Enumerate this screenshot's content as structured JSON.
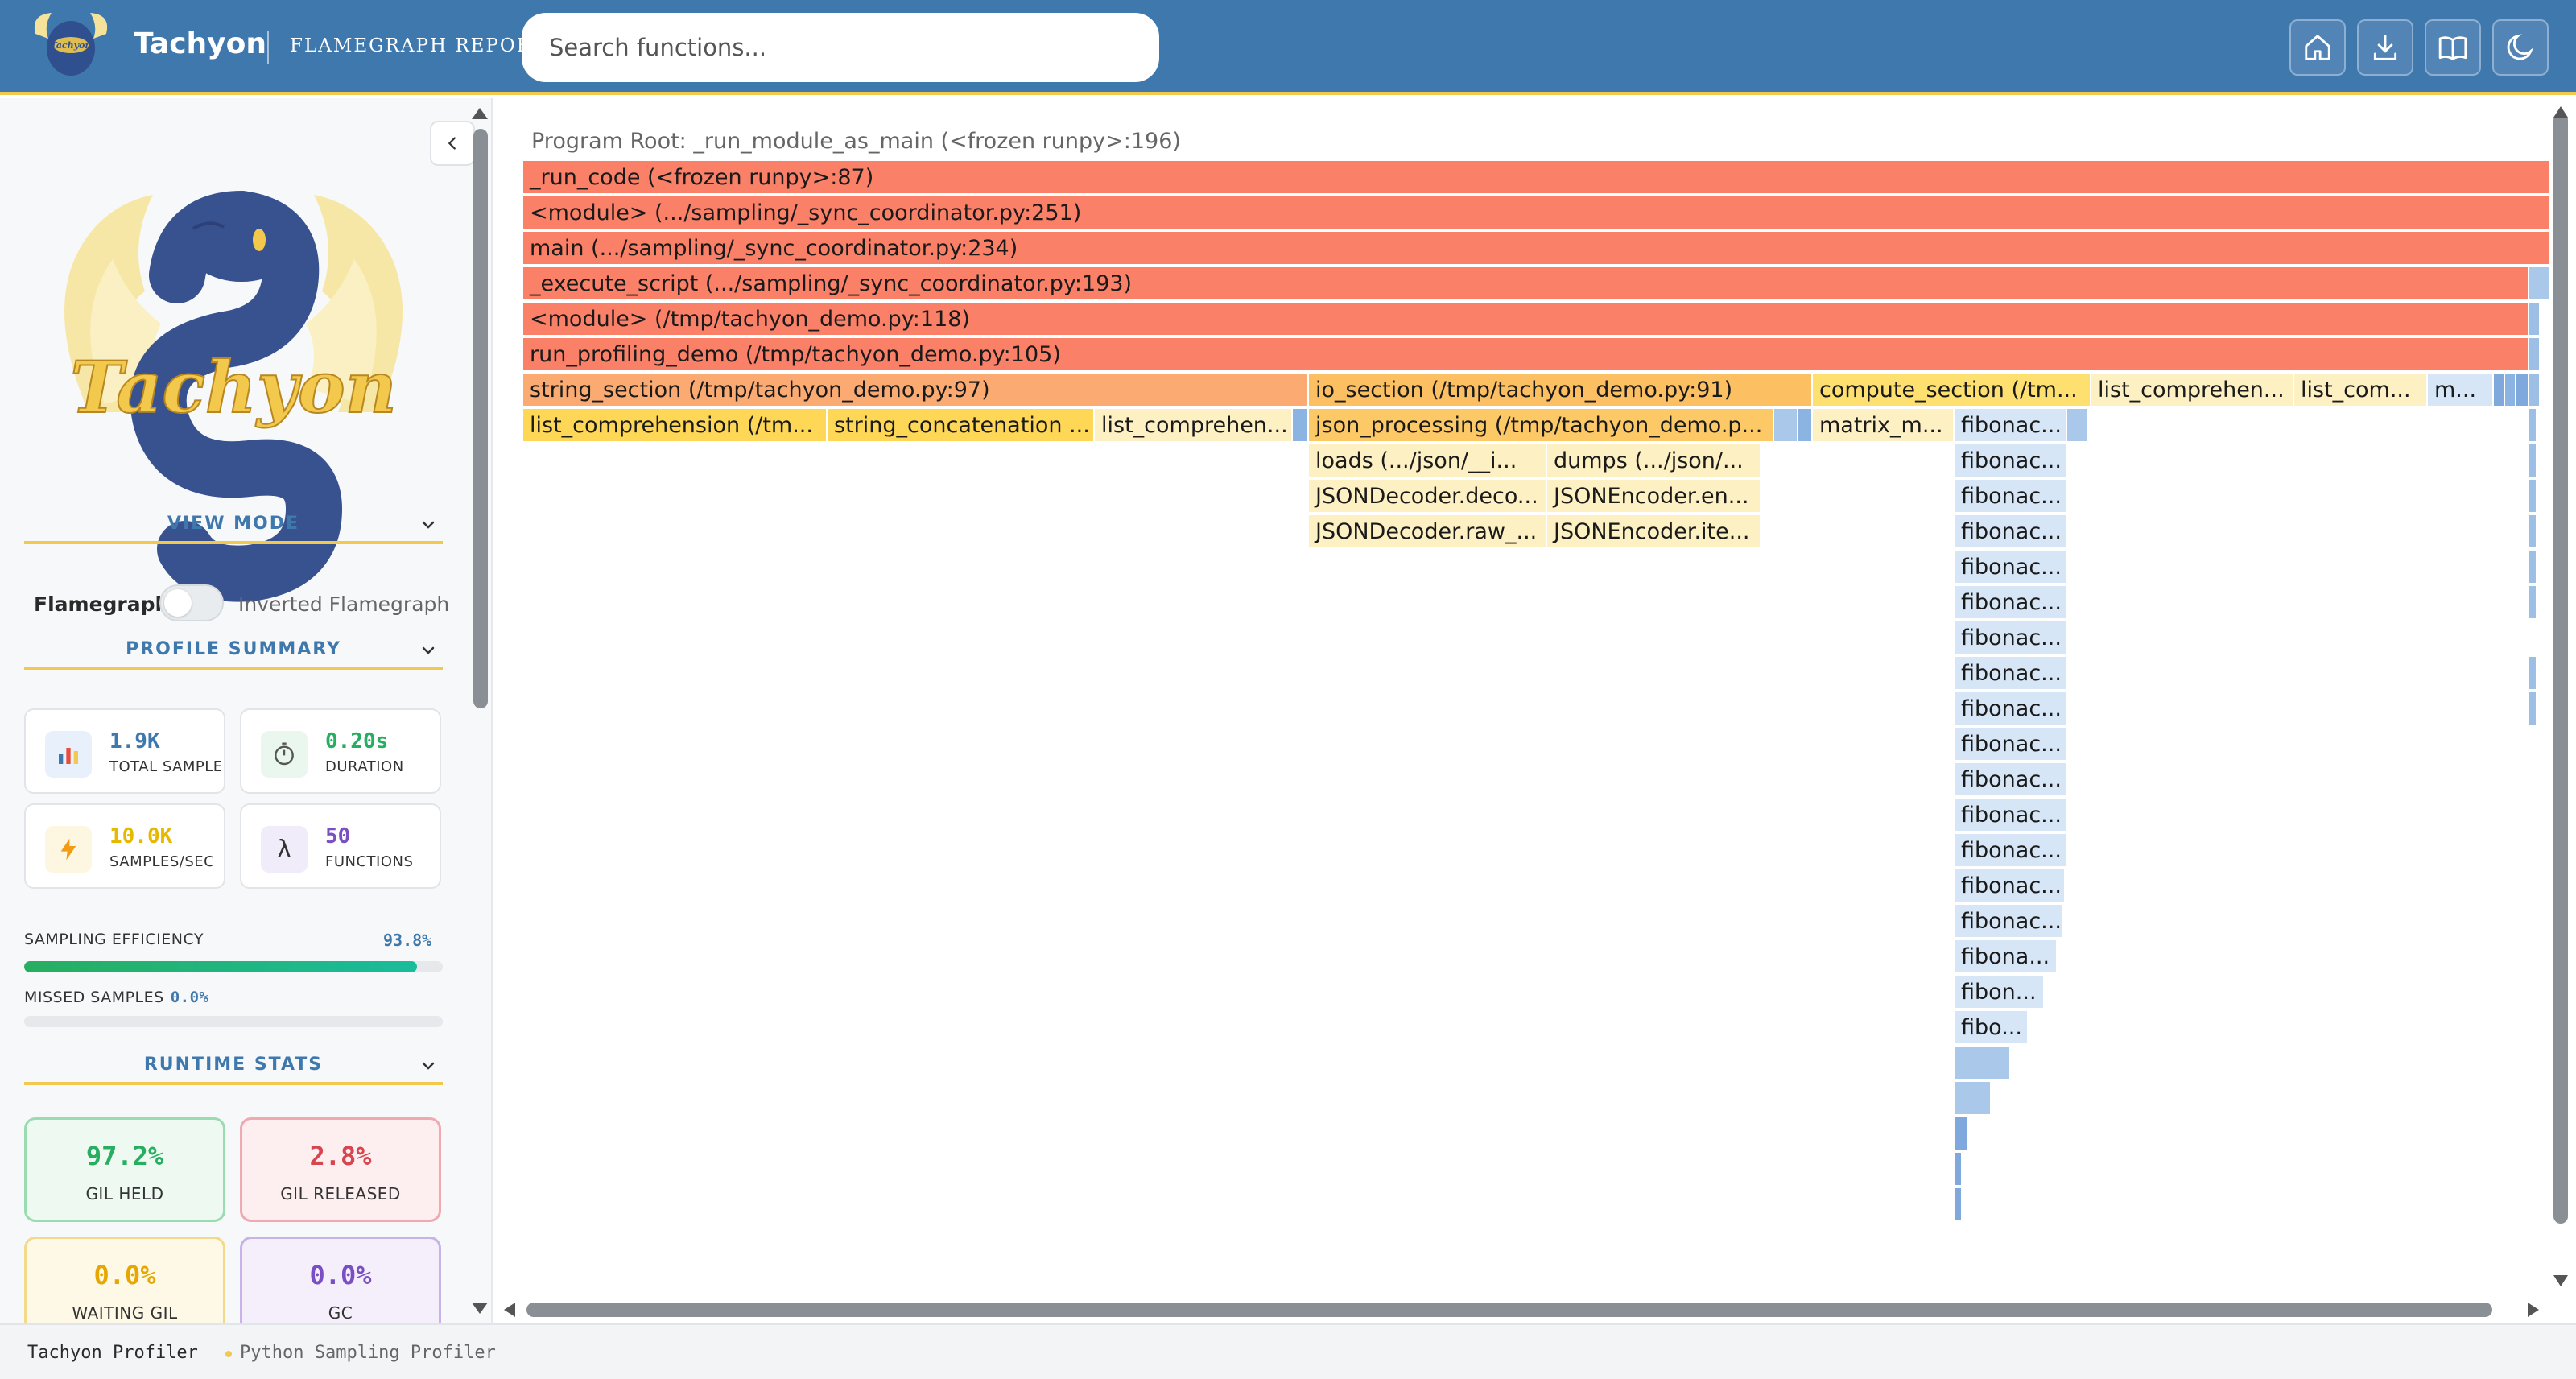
{
  "header": {
    "title": "Tachyon",
    "subtitle": "FLAMEGRAPH REPORT",
    "search_placeholder": "Search functions...",
    "buttons": [
      "home-icon",
      "download-icon",
      "book-icon",
      "moon-icon"
    ],
    "colors": {
      "bar": "#3f78ad",
      "accent": "#f2c94c"
    }
  },
  "logo": {
    "text": "Tachyon"
  },
  "sidebar": {
    "view_mode": {
      "heading": "VIEW MODE",
      "left_label": "Flamegraph",
      "right_label": "Inverted Flamegraph",
      "inverted_enabled": false
    },
    "profile_summary": {
      "heading": "PROFILE SUMMARY",
      "cards": [
        {
          "value": "1.9K",
          "label": "TOTAL SAMPLES",
          "icon": "bar-chart-icon",
          "color": "#3f78ad"
        },
        {
          "value": "0.20s",
          "label": "DURATION",
          "icon": "stopwatch-icon",
          "color": "#27ae60"
        },
        {
          "value": "10.0K",
          "label": "SAMPLES/SEC",
          "icon": "lightning-icon",
          "color": "#f1c40f"
        },
        {
          "value": "50",
          "label": "FUNCTIONS",
          "icon": "lambda-icon",
          "color": "#7b4fc4"
        }
      ],
      "sampling_efficiency": {
        "label": "SAMPLING EFFICIENCY",
        "value": "93.8%",
        "fraction": 0.938
      },
      "missed_samples": {
        "label": "MISSED SAMPLES",
        "value": "0.0%",
        "fraction": 0.0
      }
    },
    "runtime_stats": {
      "heading": "RUNTIME STATS",
      "cards": [
        {
          "value": "97.2%",
          "label": "GIL HELD",
          "color": "#27ae60"
        },
        {
          "value": "2.8%",
          "label": "GIL RELEASED",
          "color": "#d64550"
        },
        {
          "value": "0.0%",
          "label": "WAITING GIL",
          "color": "#e6a700"
        },
        {
          "value": "0.0%",
          "label": "GC",
          "color": "#7b4fc4"
        }
      ]
    }
  },
  "flamegraph": {
    "root_label": "Program Root: _run_module_as_main (<frozen runpy>:196)",
    "frames": [
      "_run_code (<frozen runpy>:87)",
      "<module> (.../sampling/_sync_coordinator.py:251)",
      "main (.../sampling/_sync_coordinator.py:234)",
      "_execute_script (.../sampling/_sync_coordinator.py:193)",
      "<module> (/tmp/tachyon_demo.py:118)",
      "run_profiling_demo (/tmp/tachyon_demo.py:105)",
      "string_section (/tmp/tachyon_demo.py:97)",
      "io_section (/tmp/tachyon_demo.py:91)",
      "compute_section (/tm...",
      "list_comprehen...",
      "list_com...",
      "m...",
      "list_comprehension (/tm...",
      "string_concatenation ...",
      "list_comprehen...",
      "json_processing (/tmp/tachyon_demo.p...",
      "matrix_m...",
      "fibonac...",
      "loads (.../json/__i...",
      "dumps (.../json/...",
      "JSONDecoder.deco...",
      "JSONEncoder.en...",
      "JSONDecoder.raw_...",
      "JSONEncoder.ite...",
      "fibona...",
      "fibon...",
      "fibo..."
    ]
  },
  "footer": {
    "name": "Tachyon Profiler",
    "description": "Python Sampling Profiler"
  }
}
